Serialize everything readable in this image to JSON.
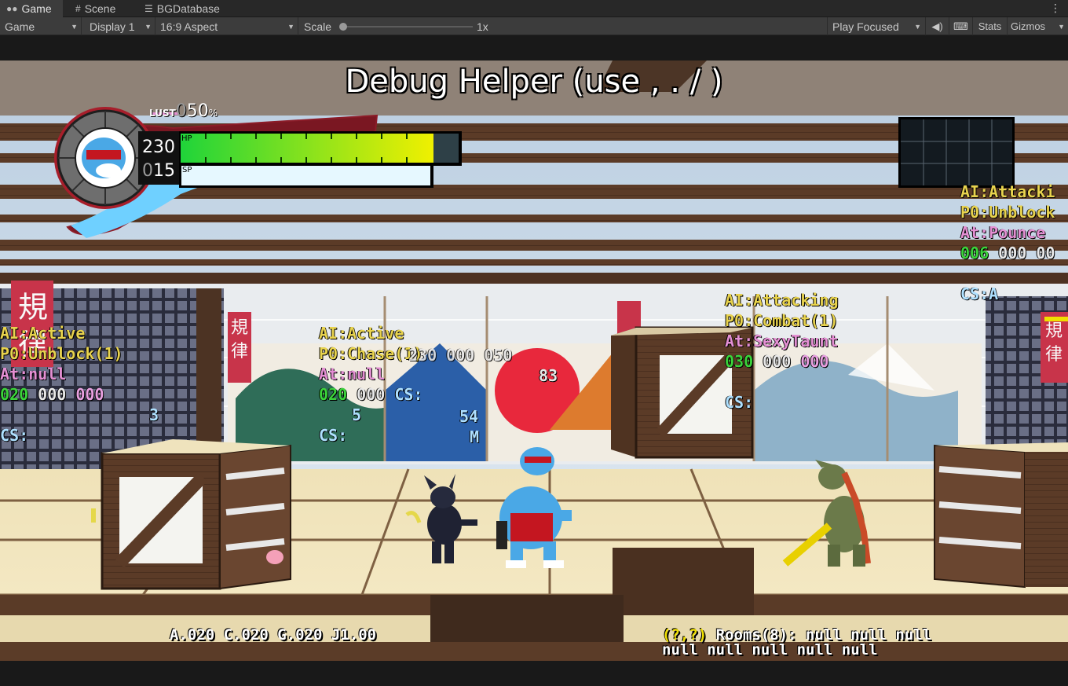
{
  "tabs": [
    {
      "label": "Game",
      "icon": "gamepad-icon"
    },
    {
      "label": "Scene",
      "icon": "grid-icon"
    },
    {
      "label": "BGDatabase",
      "icon": "database-icon"
    }
  ],
  "toolbar": {
    "view_mode": "Game",
    "display": "Display 1",
    "aspect": "16:9 Aspect",
    "scale_label": "Scale",
    "scale_value": "1x",
    "play_mode": "Play Focused",
    "stats": "Stats",
    "gizmos": "Gizmos"
  },
  "hud": {
    "title": "Debug Helper (use , . / )",
    "lust_label": "LUST",
    "lust_value_dim": "0",
    "lust_value": "50",
    "lust_unit": "%",
    "hp_value": "230",
    "hp_label": "HP",
    "hp_fill": 0.92,
    "sp_value_dim": "0",
    "sp_value": "15",
    "sp_label": "SP",
    "sp_fill": 1.0
  },
  "debug": {
    "enemy_left": {
      "ai": "AI:Active",
      "p0": "P0:Unblock(1)",
      "at": "At:null",
      "n1": "020",
      "n2": "000",
      "n3": "000",
      "cs": "CS:",
      "extra": "3"
    },
    "enemy_mid": {
      "ai": "AI:Active",
      "p0": "P0:Chase(1)",
      "overlay_nums": "230 000 050",
      "at": "At:null",
      "n1": "020",
      "n2": "000",
      "cs_a": "CS:",
      "extra1": "5",
      "cs_b": "CS:",
      "extra2": "54",
      "extra3": "M",
      "extra4": "83"
    },
    "enemy_right": {
      "ai": "AI:Attacking",
      "p0": "P0:Combat(1)",
      "at": "At:SexyTaunt",
      "n1": "030",
      "n2": "000",
      "n3": "000",
      "cs": "CS:"
    },
    "enemy_far": {
      "ai": "AI:Attacki",
      "p0": "P0:Unblock",
      "at": "At:Pounce",
      "n1": "006",
      "n2": "000",
      "n3": "00",
      "cs": "CS:A"
    }
  },
  "bottom": {
    "stats": "A.020 C.020 G.020 J1.00",
    "rooms_prefix": "(?,?)",
    "rooms_line1": " Rooms(8): null null null",
    "rooms_line2": "null null null null null"
  },
  "signs": {
    "left": "規律",
    "mid": "規律",
    "right": "規律"
  },
  "colors": {
    "hp_start": "#22d633",
    "hp_end": "#f2f200",
    "sun": "#e8283c",
    "wood": "#5a3a26",
    "paper": "#f2e7c4"
  }
}
